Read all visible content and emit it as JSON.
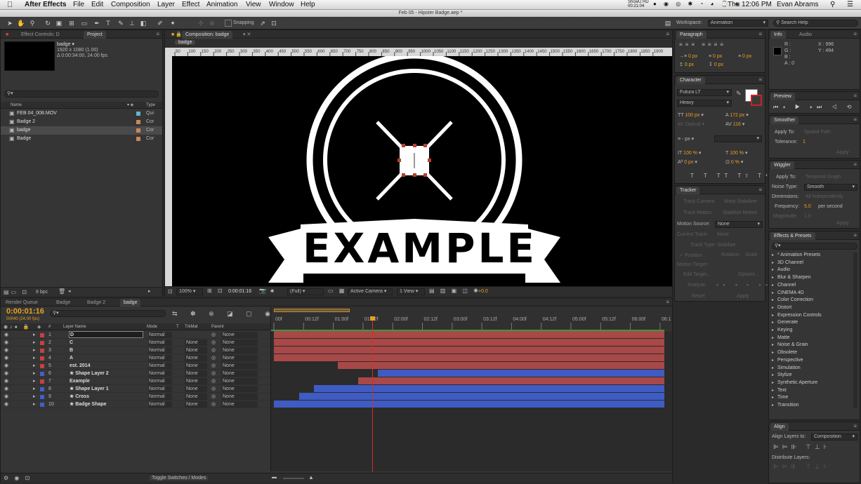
{
  "menu": {
    "app": "After Effects",
    "items": [
      "File",
      "Edit",
      "Composition",
      "Layer",
      "Effect",
      "Animation",
      "View",
      "Window",
      "Help"
    ],
    "status_badge": "ShowU HD 00:21:04",
    "clock": "Thu 12:06 PM",
    "user": "Evan Abrams"
  },
  "window": {
    "title": "Feb 05 - Hipster Badge.aep *"
  },
  "toolbar": {
    "snapping": "Snapping",
    "workspace_label": "Workspace:",
    "workspace_value": "Animation",
    "search_help": "Search Help"
  },
  "project_panel": {
    "tab_effects": "Effect Controls: D",
    "tab_project": "Project",
    "comp_name": "badge ▾",
    "comp_res": "1920 x 1080 (1.00)",
    "comp_dur": "Δ 0:00:34:00, 24.00 fps",
    "col_name": "Name",
    "col_type": "Type",
    "items": [
      {
        "name": "FEB 04_008.MOV",
        "type": "Qui",
        "color": "#5fb8c8"
      },
      {
        "name": "Badge 2",
        "type": "Cor",
        "color": "#c9875a"
      },
      {
        "name": "badge",
        "type": "Cor",
        "color": "#c9875a"
      },
      {
        "name": "Badge",
        "type": "Cor",
        "color": "#c9875a"
      }
    ],
    "bpc": "8 bpc"
  },
  "comp_panel": {
    "tab": "Composition: badge",
    "crumb": "badge",
    "ruler": [
      "50",
      "100",
      "150",
      "200",
      "250",
      "300",
      "350",
      "400",
      "450",
      "500",
      "550",
      "600",
      "650",
      "700",
      "750",
      "800",
      "850",
      "900",
      "950",
      "1000",
      "1050",
      "1100",
      "1150",
      "1200",
      "1250",
      "1300",
      "1350",
      "1400",
      "1450",
      "1500",
      "1550",
      "1600",
      "1650",
      "1700",
      "1750",
      "1800",
      "1850",
      "1900"
    ],
    "badge_text": "EXAMPLE",
    "zoom": "100%",
    "timecode": "0:00:01:16",
    "resolution": "(Full)",
    "camera": "Active Camera",
    "views": "1 View",
    "exposure": "+0.0"
  },
  "paragraph": {
    "title": "Paragraph",
    "fields": [
      "0 px",
      "0 px",
      "0 px",
      "0 px",
      "0 px"
    ]
  },
  "character": {
    "title": "Character",
    "font": "Futura LT",
    "style": "Heavy",
    "size": "100 px",
    "leading": "172 px",
    "kerning": "Optical",
    "tracking": "116",
    "stroke": "- px",
    "vscale": "100 %",
    "hscale": "100 %",
    "baseline": "0 px",
    "tsume": "0 %"
  },
  "tracker": {
    "title": "Tracker",
    "track_camera": "Track Camera",
    "warp": "Warp Stabilizer",
    "track_motion": "Track Motion",
    "stabilize": "Stabilize Motion",
    "motion_source_label": "Motion Source:",
    "motion_source": "None",
    "current_track_label": "Current Track:",
    "current_track": "None",
    "track_type_label": "Track Type:",
    "track_type": "Stabilize",
    "position": "Position",
    "rotation": "Rotation",
    "scale": "Scale",
    "motion_target": "Motion Target:",
    "edit_target": "Edit Target...",
    "options": "Options...",
    "analyze": "Analyze:",
    "reset": "Reset",
    "apply": "Apply"
  },
  "info": {
    "tab_info": "Info",
    "tab_audio": "Audio",
    "r": "R :",
    "g": "G :",
    "b": "B :",
    "a": "A : 0",
    "x": "X : 996",
    "y": "Y : 494"
  },
  "preview": {
    "title": "Preview"
  },
  "smoother": {
    "title": "Smoother",
    "apply_to_label": "Apply To:",
    "apply_to": "Spatial Path",
    "tolerance_label": "Tolerance:",
    "tolerance": "1",
    "apply": "Apply"
  },
  "wiggler": {
    "title": "Wiggler",
    "apply_to_label": "Apply To:",
    "apply_to": "Temporal Graph",
    "noise_label": "Noise Type:",
    "noise": "Smooth",
    "dims_label": "Dimensions:",
    "dims": "All Independently",
    "freq_label": "Frequency:",
    "freq": "5.0",
    "freq_unit": "per second",
    "mag_label": "Magnitude:",
    "mag": "1.0",
    "apply": "Apply"
  },
  "effects": {
    "title": "Effects & Presets",
    "items": [
      "* Animation Presets",
      "3D Channel",
      "Audio",
      "Blur & Sharpen",
      "Channel",
      "CINEMA 4D",
      "Color Correction",
      "Distort",
      "Expression Controls",
      "Generate",
      "Keying",
      "Matte",
      "Noise & Grain",
      "Obsolete",
      "Perspective",
      "Simulation",
      "Stylize",
      "Synthetic Aperture",
      "Text",
      "Time",
      "Transition"
    ]
  },
  "align": {
    "title": "Align",
    "align_to_label": "Align Layers to:",
    "align_to": "Composition",
    "distribute": "Distribute Layers:"
  },
  "timeline": {
    "tabs": [
      "Render Queue",
      "Badge",
      "Badge 2",
      "badge"
    ],
    "timecode": "0:00:01:16",
    "fps": "00040 (24.00 fps)",
    "col_layer": "Layer Name",
    "col_mode": "Mode",
    "col_t": "T",
    "col_trkmat": "TrkMat",
    "col_parent": "Parent",
    "ticks": [
      "00f",
      "00:12f",
      "01:00f",
      "01:12f",
      "02:00f",
      "02:12f",
      "03:00f",
      "03:12f",
      "04:00f",
      "04:12f",
      "05:00f",
      "05:12f",
      "06:00f",
      "06:1"
    ],
    "layers": [
      {
        "num": "1",
        "name": "D",
        "color": "#c84040",
        "mode": "Normal",
        "trk": "",
        "parent": "None",
        "start": 0,
        "bar": "#a94848"
      },
      {
        "num": "2",
        "name": "C",
        "color": "#c84040",
        "mode": "Normal",
        "trk": "None",
        "parent": "None",
        "start": 0,
        "bar": "#a94848"
      },
      {
        "num": "3",
        "name": "B",
        "color": "#c84040",
        "mode": "Normal",
        "trk": "None",
        "parent": "None",
        "start": 0,
        "bar": "#a94848"
      },
      {
        "num": "4",
        "name": "A",
        "color": "#c84040",
        "mode": "Normal",
        "trk": "None",
        "parent": "None",
        "start": 0,
        "bar": "#a94848"
      },
      {
        "num": "5",
        "name": "est. 2014",
        "color": "#c84040",
        "mode": "Normal",
        "trk": "None",
        "parent": "None",
        "start": 1.08,
        "bar": "#a94848"
      },
      {
        "num": "6",
        "name": "★ Shape Layer 2",
        "color": "#4060c8",
        "mode": "Normal",
        "trk": "None",
        "parent": "None",
        "start": 1.75,
        "bar": "#3e5cc4"
      },
      {
        "num": "7",
        "name": "Example",
        "color": "#c84040",
        "mode": "Normal",
        "trk": "None",
        "parent": "None",
        "start": 1.42,
        "bar": "#a94848"
      },
      {
        "num": "8",
        "name": "★ Shape Layer 1",
        "color": "#4060c8",
        "mode": "Normal",
        "trk": "None",
        "parent": "None",
        "start": 0.67,
        "bar": "#3e5cc4"
      },
      {
        "num": "9",
        "name": "★ Cross",
        "color": "#4060c8",
        "mode": "Normal",
        "trk": "None",
        "parent": "None",
        "start": 0.42,
        "bar": "#3e5cc4"
      },
      {
        "num": "10",
        "name": "★ Badge Shape",
        "color": "#4060c8",
        "mode": "Normal",
        "trk": "None",
        "parent": "None",
        "start": 0,
        "bar": "#3e5cc4"
      }
    ],
    "toggle": "Toggle Switches / Modes",
    "playhead_sec": 1.67
  }
}
